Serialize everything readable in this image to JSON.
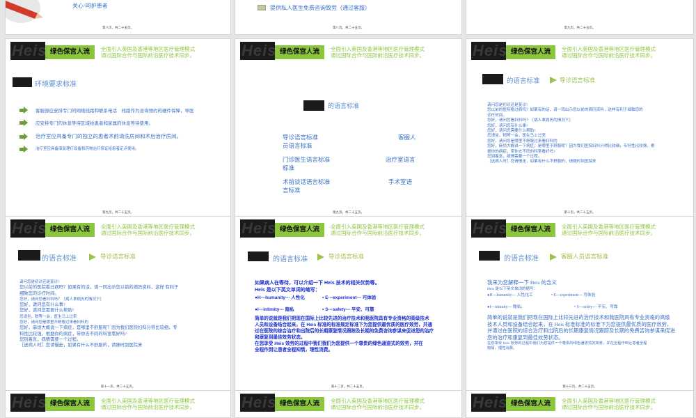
{
  "header": {
    "logo": "Heis",
    "badge": "绿色保宫人流",
    "tagline_1": "全面引入英国及香港等地区医疗管理模式",
    "tagline_2": "通过国际合作与国际前沿医疗技术同步。"
  },
  "top": {
    "s1_text": "关心·呵护患者",
    "s2_text": "提供私人医生免费咨询致劳（通过客服）",
    "pages": [
      "第八页，共二十五页。",
      "第八页，共二十五页。",
      "第九页，共二十五页。"
    ]
  },
  "s4": {
    "title": "环境要求标准",
    "items": [
      "客服部应安排专门的网络线路和联系电话　线路作为咨询预约的硬件保障，导医",
      "应安排专门的休息等待区域给患者和家属的休息等待使用。",
      "治疗室应具备专门的独立的患者术前清洗房间和术后治疗房间。",
      "治疗室应具备康复理疗设备和药物治疗保证给患者定点使用。"
    ],
    "page": "第九页，共二十五页。"
  },
  "s5": {
    "title": "的语言标准",
    "items": [
      [
        "导诊语言标准",
        "客服人",
        "员语言标准"
      ],
      [
        "门诊医生语言标准",
        "治疗室语言",
        "标准"
      ],
      [
        "术前谈话语言标准",
        "手术室语",
        "言标准"
      ]
    ],
    "page": "第九页，共二十五页。"
  },
  "s6": {
    "title": "的语言标准",
    "subtitle": "导诊语言标准",
    "lines": [
      "请问您是初诊还是复诊?",
      "您以前的医院看过病吗？如果有的话，请一同出示您以前的病历资料，这样有利于细致您的",
      "诊疗时间。",
      "您好，请问您看妇科吗？［病人拿病历的情况下］",
      "您好，请问您有什么事?",
      "您好，请问您需要什么帮助?",
      "您请坐，稍等一会，医生马上过来",
      "您好，请问您是哪里不舒服过来看妇科的",
      "您好，麻烦大概说一下病症，是哪里不舒服呢？因为我们医院妇科分得比较细，专科性比较强，根",
      "据你的病症，带你去不同的科室看好吗?",
      "您别着急，病情需要一个过程。",
      "［送病人时］您请慢走，如果有什么不舒服的，请随时到医院来"
    ],
    "page": "第十页，共二十五页。"
  },
  "s7": {
    "title": "的语言标准",
    "subtitle": "导诊语言标准",
    "lines": [
      "请问您是初诊还是复诊?",
      "您以前的医院看过病吗？如果有的话，请一同出示您以前的病历资料，这样 有利于",
      "细致您的诊疗时间。",
      "您好，请问您看妇科吗？［病人拿病历的情况下］",
      "您好，请问您有什么事?",
      "您好，请问您需要什么帮助?",
      "您请坐，稍等一会，医生马上过来",
      "您好，请问您是哪里不舒服过来看妇科的",
      "您好，麻烦大概说一下病症，是哪里不舒服呢？因为我们医院妇科分得比较细，专",
      "科性比较强，根据你的病症，带你去不同的科室看好吗?",
      "您别着急，病情需要一个过程。",
      "［送病人时］您请慢走，如果有什么不舒服的，请随时到医院来"
    ],
    "page": "第十一页，共二十五页。"
  },
  "s8": {
    "l1": "如果病人在等待，可以介绍一下 Heis 技术的相关优势等。",
    "l2": "Heis 是以下英文单词的缩写：",
    "h": "●H---humanity--- 人性化",
    "e": "• E---experiment--- 可体验",
    "i": "●I---intimity--- 隐私",
    "s": "• S---safety--- 平安、可靠",
    "para": [
      "简单的说就是我们把现在国际上比较先进的治疗技术和我医院具有专业资格的高级技术",
      "人员和设备结合起来，在 Heis 标准的标准规定标准下为您提供最优质的医疗效劳，并通",
      "过在医院的综合治疗和出院后的长期康复情况跟踪及长期的免费咨询参谋来促进您的治疗",
      "和康复到最佳效劳状态。"
    ],
    "para2": [
      "在您享受 Heis 效劳的过程中我们我们为您提供一个尊贵的绿色通道式的效劳，并在",
      "全程作到让患者全程知情，理性消费。"
    ],
    "page": "第十二页，共二十五页。"
  },
  "s9": {
    "title": "的语言标准",
    "subtitle": "客服人员语言标准",
    "l0": "我来为您解释一下 Heis 的含义",
    "l1": "Heis 是以下英文单词的缩写：",
    "h": "●H---humanity--- 人性化工",
    "e": "• E---experiment--- 可体验",
    "i": "●I---intimity--- 隐私、",
    "s": "• S---safety--- 平安、可靠",
    "para": [
      "简单的说就是我们把现在国际上比较先进的治疗技术和我医院具有专业资格的高级",
      "技术人员和设备结合起来，在 Heis 标准标准的标准下为您提供最优质的医疗效劳，",
      "并通过在医院的综合治疗和出院后的长期康复情况跟踪及长期的免费咨询参谋来促进",
      "您的治疗和康复到最佳效劳状态。"
    ],
    "para2": [
      "在您享受 Heis 效劳的过程中我们为您提供一个尊贵的绿色通道式的效劳，并在全程作到让患者全程",
      "知情，理性消费。"
    ],
    "page": "第十三页，共二十五页。"
  },
  "colors": {
    "accent": "#8cc63f",
    "text_blue": "#3a6fc4",
    "bold_blue": "#1b2fd0",
    "title_blue": "#5b8fd0"
  }
}
